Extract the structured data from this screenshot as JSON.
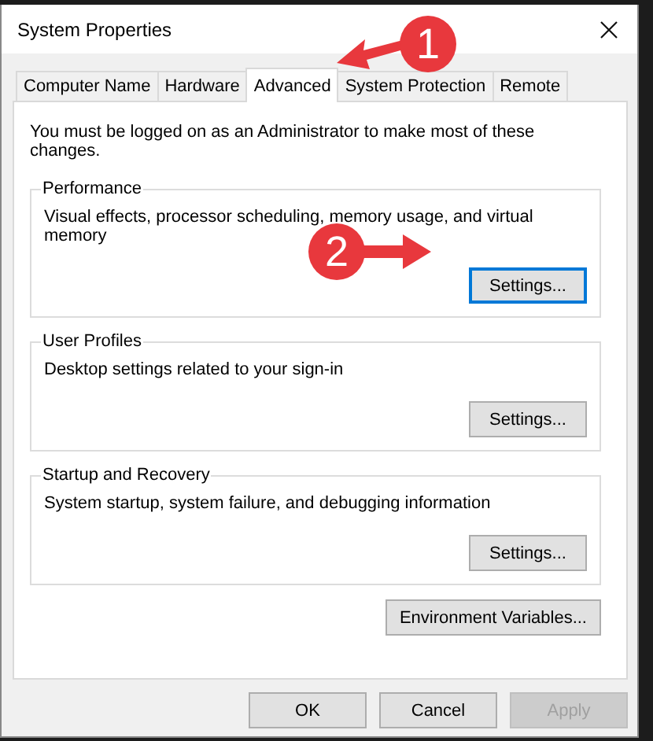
{
  "window": {
    "title": "System Properties"
  },
  "tabs": [
    {
      "label": "Computer Name",
      "selected": false
    },
    {
      "label": "Hardware",
      "selected": false
    },
    {
      "label": "Advanced",
      "selected": true
    },
    {
      "label": "System Protection",
      "selected": false
    },
    {
      "label": "Remote",
      "selected": false
    }
  ],
  "notice": "You must be logged on as an Administrator to make most of these changes.",
  "groups": [
    {
      "title": "Performance",
      "description": "Visual effects, processor scheduling, memory usage, and virtual memory",
      "button": {
        "label": "Settings...",
        "focused": true
      }
    },
    {
      "title": "User Profiles",
      "description": "Desktop settings related to your sign-in",
      "button": {
        "label": "Settings...",
        "focused": false
      }
    },
    {
      "title": "Startup and Recovery",
      "description": "System startup, system failure, and debugging information",
      "button": {
        "label": "Settings...",
        "focused": false
      }
    }
  ],
  "environment_button": "Environment Variables...",
  "footer_buttons": [
    {
      "label": "OK",
      "disabled": false
    },
    {
      "label": "Cancel",
      "disabled": false
    },
    {
      "label": "Apply",
      "disabled": true
    }
  ],
  "annotations": [
    {
      "label": "1"
    },
    {
      "label": "2"
    }
  ]
}
